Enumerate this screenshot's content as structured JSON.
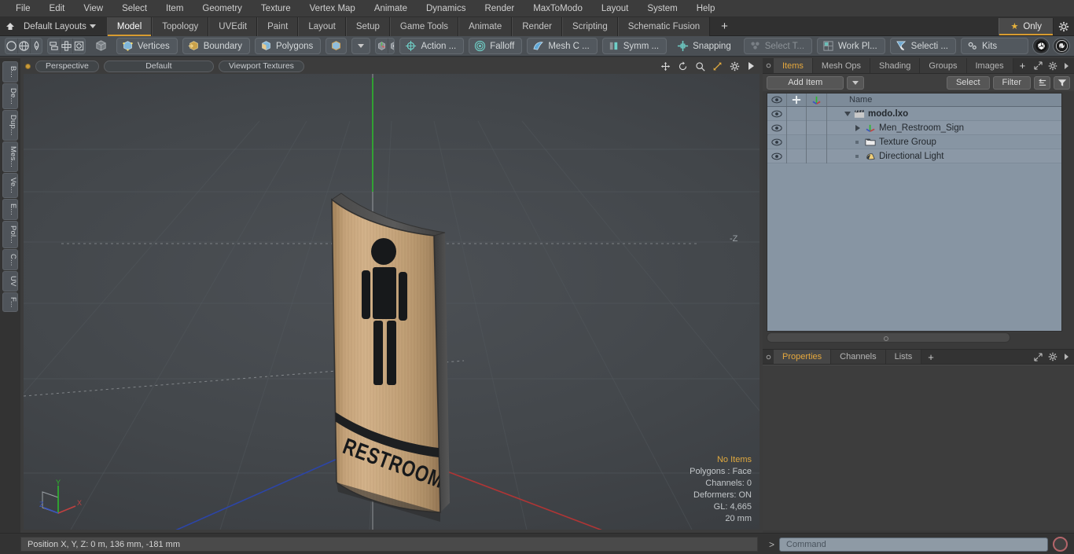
{
  "menu": {
    "items": [
      "File",
      "Edit",
      "View",
      "Select",
      "Item",
      "Geometry",
      "Texture",
      "Vertex Map",
      "Animate",
      "Dynamics",
      "Render",
      "MaxToModo",
      "Layout",
      "System",
      "Help"
    ]
  },
  "layoutbar": {
    "home_icon": "home-up-icon",
    "layout_label": "Default Layouts",
    "tabs": [
      {
        "label": "Model",
        "active": true
      },
      {
        "label": "Topology",
        "active": false
      },
      {
        "label": "UVEdit",
        "active": false
      },
      {
        "label": "Paint",
        "active": false
      },
      {
        "label": "Layout",
        "active": false
      },
      {
        "label": "Setup",
        "active": false
      },
      {
        "label": "Game Tools",
        "active": false
      },
      {
        "label": "Animate",
        "active": false
      },
      {
        "label": "Render",
        "active": false
      },
      {
        "label": "Scripting",
        "active": false
      },
      {
        "label": "Schematic Fusion",
        "active": false
      }
    ],
    "add_tab_label": "+",
    "only_label": "Only",
    "star_icon": "star-icon",
    "gear_icon": "gear-icon",
    "accent": "#d79b30"
  },
  "toolbar": {
    "shape_icons": [
      "circle-icon",
      "globe-icon",
      "pen-icon",
      "curve-icon"
    ],
    "arrange_icons": [
      "align-icon",
      "move-icon",
      "center-icon",
      "rotate-icon"
    ],
    "cube_icon": "cube-icon",
    "modes": [
      {
        "label": "Vertices",
        "icon": "vertices-icon"
      },
      {
        "label": "Boundary",
        "icon": "boundary-icon"
      },
      {
        "label": "Polygons",
        "icon": "polygons-icon"
      }
    ],
    "item_icon": "item-cube-icon",
    "dropdown_icon": "chevron-down-icon",
    "pivot_icons": [
      "pivot-icon",
      "center-pivot-icon"
    ],
    "tools": [
      {
        "label": "Action   ...",
        "icon": "action-center-icon",
        "dim": false
      },
      {
        "label": "Falloff",
        "icon": "falloff-icon",
        "dim": false
      },
      {
        "label": "Mesh C ...",
        "icon": "mesh-constraint-icon",
        "dim": false
      },
      {
        "label": "Symm ...",
        "icon": "symmetry-icon",
        "dim": false
      },
      {
        "label": "Snapping",
        "icon": "snapping-icon",
        "dim": false
      },
      {
        "label": "Select T...",
        "icon": "select-through-icon",
        "dim": true
      },
      {
        "label": "Work Pl...",
        "icon": "work-plane-icon",
        "dim": false
      },
      {
        "label": "Selecti ...",
        "icon": "selection-icon",
        "dim": false
      }
    ],
    "kits_label": "Kits",
    "kits_icon": "kits-gears-icon",
    "unity_icon": "unity-icon",
    "unreal_icon": "unreal-icon"
  },
  "vertical_tabs": [
    "B...",
    "De...",
    "Dup...",
    "Mes...",
    "Ve...",
    "E...",
    "Pol...",
    "C...",
    "UV",
    "F..."
  ],
  "viewport": {
    "view_mode": "Perspective",
    "shading_preset": "Default",
    "display_mode": "Viewport Textures",
    "control_icons": [
      "pan-icon",
      "rotate-icon",
      "zoom-icon",
      "fit-icon",
      "settings-gear-icon",
      "play-arrow-icon"
    ],
    "axis_label_z": "-Z",
    "gizmo_axes": [
      "Y",
      "X",
      "Z"
    ],
    "info": {
      "selection": "No Items",
      "polygons": "Polygons : Face",
      "channels": "Channels: 0",
      "deformers": "Deformers: ON",
      "gl": "GL: 4,665",
      "grid": "20 mm"
    },
    "sign": {
      "text": "RESTROOM",
      "pictogram": "male-figure-icon",
      "wood_color": "#c2a075",
      "ink_color": "#1b1b1b"
    }
  },
  "items_panel": {
    "tabs": [
      {
        "label": "Items",
        "active": true
      },
      {
        "label": "Mesh Ops",
        "active": false
      },
      {
        "label": "Shading",
        "active": false
      },
      {
        "label": "Groups",
        "active": false
      },
      {
        "label": "Images",
        "active": false
      }
    ],
    "add_tab_label": "+",
    "expand_icon": "expand-icon",
    "gear_icon": "gear-icon",
    "arrow_icon": "chevron-right-icon",
    "add_item_label": "Add Item",
    "select_label": "Select",
    "filter_label": "Filter",
    "list_icon": "list-options-icon",
    "funnel_icon": "funnel-icon",
    "columns": [
      "eye-column",
      "add-column",
      "axis-column",
      "Name"
    ],
    "rows": [
      {
        "name": "modo.lxo",
        "icon": "scene-clapper-icon",
        "depth": 0,
        "bold": true,
        "expander": "down"
      },
      {
        "name": "Men_Restroom_Sign",
        "icon": "mesh-axis-icon",
        "depth": 1,
        "bold": false,
        "expander": "right"
      },
      {
        "name": "Texture Group",
        "icon": "texture-group-icon",
        "depth": 1,
        "bold": false,
        "expander": "none"
      },
      {
        "name": "Directional Light",
        "icon": "directional-light-icon",
        "depth": 1,
        "bold": false,
        "expander": "none"
      }
    ]
  },
  "properties_panel": {
    "tabs": [
      {
        "label": "Properties",
        "active": true
      },
      {
        "label": "Channels",
        "active": false
      },
      {
        "label": "Lists",
        "active": false
      }
    ],
    "add_tab_label": "+",
    "expand_icon": "expand-icon",
    "gear_icon": "gear-icon",
    "arrow_icon": "chevron-right-icon"
  },
  "statusbar": {
    "position_text": "Position X, Y, Z:   0 m, 136 mm, -181 mm",
    "command_prompt": ">",
    "command_placeholder": "Command",
    "record_icon": "record-circle-icon"
  }
}
